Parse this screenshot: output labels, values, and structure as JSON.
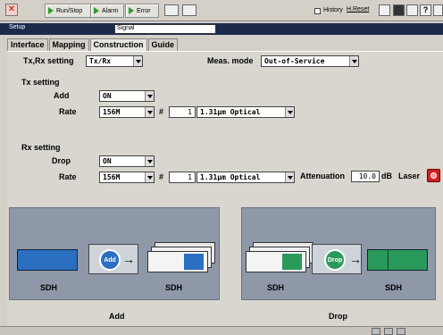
{
  "toolbar": {
    "run_stop": "Run/Stop",
    "alarm": "Alarm",
    "error": "Error",
    "history": "History",
    "h_reset": "H.Reset"
  },
  "setup_bar": {
    "title": "Setup",
    "signal": "Signal"
  },
  "tabs": [
    "Interface",
    "Mapping",
    "Construction",
    "Guide"
  ],
  "form": {
    "txrx_label": "Tx,Rx setting",
    "txrx_value": "Tx/Rx",
    "meas_label": "Meas. mode",
    "meas_value": "Out-of-Service",
    "tx_heading": "Tx setting",
    "add_label": "Add",
    "add_value": "ON",
    "tx_rate_label": "Rate",
    "tx_rate_value": "156M",
    "tx_hash": "#",
    "tx_channel": "1",
    "tx_optical": "1.31µm Optical",
    "rx_heading": "Rx setting",
    "drop_label": "Drop",
    "drop_value": "ON",
    "rx_rate_label": "Rate",
    "rx_rate_value": "156M",
    "rx_hash": "#",
    "rx_channel": "1",
    "rx_optical": "1.31µm Optical",
    "atten_label": "Attenuation",
    "atten_value": "10.0",
    "atten_unit": "dB",
    "laser_label": "Laser"
  },
  "diagrams": {
    "add": {
      "left": "SDH",
      "badge": "Add",
      "right": "SDH",
      "caption": "Add"
    },
    "drop": {
      "left": "SDH",
      "badge": "Drop",
      "right": "SDH",
      "caption": "Drop"
    }
  },
  "colors": {
    "add_accent": "#2a6fc0",
    "drop_accent": "#2a9a5a",
    "laser": "#d02020",
    "setup_bar": "#1c2a4c"
  }
}
